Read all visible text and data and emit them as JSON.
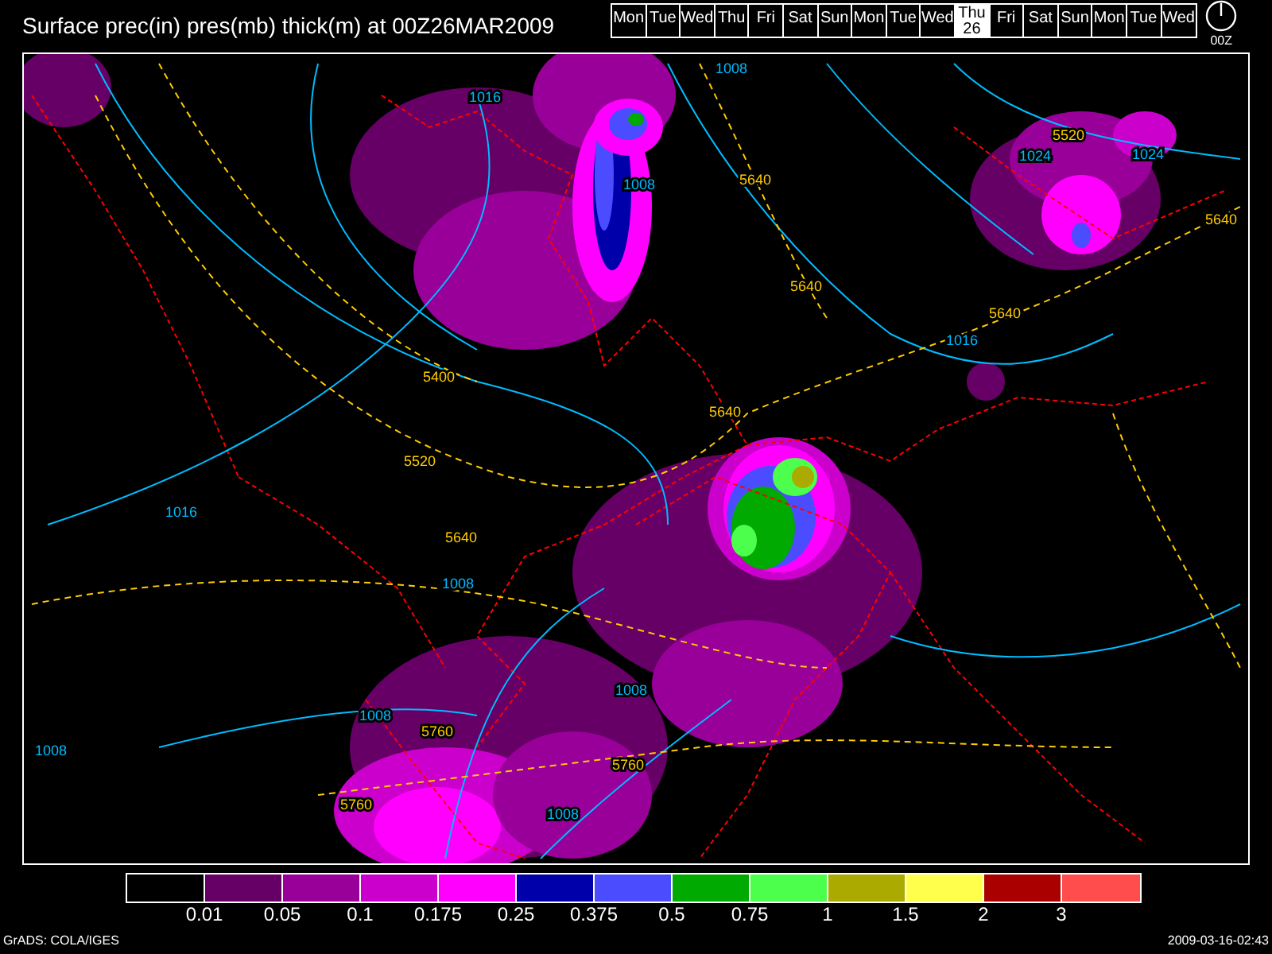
{
  "title": "Surface prec(in) pres(mb) thick(m) at 00Z26MAR2009",
  "days": [
    {
      "label": "Mon",
      "selected": false
    },
    {
      "label": "Tue",
      "selected": false
    },
    {
      "label": "Wed",
      "selected": false
    },
    {
      "label": "Thu",
      "selected": false
    },
    {
      "label": "Fri",
      "selected": false
    },
    {
      "label": "Sat",
      "selected": false
    },
    {
      "label": "Sun",
      "selected": false
    },
    {
      "label": "Mon",
      "selected": false
    },
    {
      "label": "Tue",
      "selected": false
    },
    {
      "label": "Wed",
      "selected": false
    },
    {
      "label": "Thu",
      "date": "26",
      "selected": true
    },
    {
      "label": "Fri",
      "selected": false
    },
    {
      "label": "Sat",
      "selected": false
    },
    {
      "label": "Sun",
      "selected": false
    },
    {
      "label": "Mon",
      "selected": false
    },
    {
      "label": "Tue",
      "selected": false
    },
    {
      "label": "Wed",
      "selected": false
    }
  ],
  "clock_label": "00Z",
  "map_labels": [
    {
      "text": "1008",
      "kind": "pressure"
    },
    {
      "text": "1016",
      "kind": "pressure"
    },
    {
      "text": "1008",
      "kind": "pressure"
    },
    {
      "text": "5640",
      "kind": "thickness"
    },
    {
      "text": "5520",
      "kind": "thickness"
    },
    {
      "text": "1024",
      "kind": "pressure"
    },
    {
      "text": "1024",
      "kind": "pressure"
    },
    {
      "text": "5640",
      "kind": "thickness"
    },
    {
      "text": "5640",
      "kind": "thickness"
    },
    {
      "text": "1016",
      "kind": "pressure"
    },
    {
      "text": "5640",
      "kind": "thickness"
    },
    {
      "text": "5400",
      "kind": "thickness"
    },
    {
      "text": "5640",
      "kind": "thickness"
    },
    {
      "text": "5520",
      "kind": "thickness"
    },
    {
      "text": "1016",
      "kind": "pressure"
    },
    {
      "text": "5640",
      "kind": "thickness"
    },
    {
      "text": "1008",
      "kind": "pressure"
    },
    {
      "text": "1008",
      "kind": "pressure"
    },
    {
      "text": "1008",
      "kind": "pressure"
    },
    {
      "text": "5760",
      "kind": "thickness"
    },
    {
      "text": "1008",
      "kind": "pressure"
    },
    {
      "text": "5760",
      "kind": "thickness"
    },
    {
      "text": "5760",
      "kind": "thickness"
    },
    {
      "text": "1008",
      "kind": "pressure"
    }
  ],
  "legend": {
    "bins": [
      {
        "color": "#000000"
      },
      {
        "color": "#660066"
      },
      {
        "color": "#990099"
      },
      {
        "color": "#cc00cc"
      },
      {
        "color": "#ff00ff"
      },
      {
        "color": "#0000aa"
      },
      {
        "color": "#4c4cff"
      },
      {
        "color": "#00aa00"
      },
      {
        "color": "#4cff4c"
      },
      {
        "color": "#aaaa00"
      },
      {
        "color": "#ffff4c"
      },
      {
        "color": "#aa0000"
      },
      {
        "color": "#ff4c4c"
      }
    ],
    "labels": [
      "0.01",
      "0.05",
      "0.1",
      "0.175",
      "0.25",
      "0.375",
      "0.5",
      "0.75",
      "1",
      "1.5",
      "2",
      "3"
    ]
  },
  "footer": {
    "left": "GrADS: COLA/IGES",
    "right": "2009-03-16-02:43"
  }
}
